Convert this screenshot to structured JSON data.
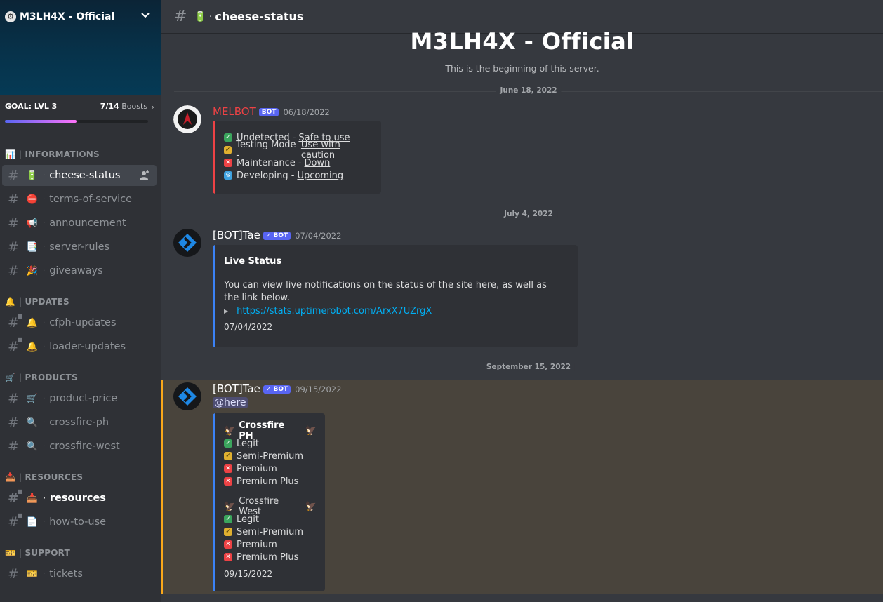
{
  "server": {
    "name": "M3LH4X - Official",
    "goal_label": "GOAL: LVL 3",
    "boost_count": "7/14",
    "boost_label": "Boosts",
    "boost_progress": 0.5
  },
  "sidebar": {
    "categories": [
      {
        "emoji": "📊",
        "label": "| INFORMATIONS"
      },
      {
        "emoji": "🔔",
        "label": "| UPDATES"
      },
      {
        "emoji": "🛒",
        "label": "| PRODUCTS"
      },
      {
        "emoji": "📥",
        "label": "| RESOURCES"
      },
      {
        "emoji": "🎫",
        "label": "| SUPPORT"
      }
    ],
    "channels": [
      {
        "emoji": "🔋",
        "label": "cheese-status"
      },
      {
        "emoji": "⛔",
        "label": "terms-of-service"
      },
      {
        "emoji": "📢",
        "label": "announcement"
      },
      {
        "emoji": "📑",
        "label": "server-rules"
      },
      {
        "emoji": "🎉",
        "label": "giveaways"
      },
      {
        "emoji": "🔔",
        "label": "cfph-updates"
      },
      {
        "emoji": "🔔",
        "label": "loader-updates"
      },
      {
        "emoji": "🛒",
        "label": "product-price"
      },
      {
        "emoji": "🔍",
        "label": "crossfire-ph"
      },
      {
        "emoji": "🔍",
        "label": "crossfire-west"
      },
      {
        "emoji": "📥",
        "label": "resources"
      },
      {
        "emoji": "📄",
        "label": "how-to-use"
      },
      {
        "emoji": "🎫",
        "label": "tickets"
      }
    ],
    "dot": "·"
  },
  "topbar": {
    "hash": "#",
    "emoji": "🔋",
    "dot": "·",
    "channel": "cheese-status"
  },
  "welcome": {
    "title": "M3LH4X - Official",
    "subtitle": "This is the beginning of this server."
  },
  "dividers": [
    "June 18, 2022",
    "July 4, 2022",
    "September 15, 2022"
  ],
  "messages": [
    {
      "author": "MELBOT",
      "author_color": "#ed4245",
      "badge": "BOT",
      "timestamp": "06/18/2022",
      "lines": [
        {
          "icon": "ok",
          "text": "Undetected -",
          "link": "Safe to use"
        },
        {
          "icon": "warn",
          "text": "Testing Mode -",
          "link": "Use with caution"
        },
        {
          "icon": "down",
          "text": "Maintenance -",
          "link": "Down"
        },
        {
          "icon": "dev",
          "text": "Developing -",
          "link": "Upcoming"
        }
      ]
    },
    {
      "author": "[BOT]Tae",
      "author_color": "#ffffff",
      "badge": "✓ BOT",
      "timestamp": "07/04/2022",
      "embed_title": "Live Status",
      "embed_text": "You can view live notifications on the status of the site here, as well as the link below.",
      "embed_link": "https://stats.uptimerobot.com/ArxX7UZrgX",
      "embed_footer": "07/04/2022"
    },
    {
      "author": "[BOT]Tae",
      "author_color": "#ffffff",
      "badge": "✓ BOT",
      "timestamp": "09/15/2022",
      "mention": "@here",
      "sections": [
        {
          "title": "Crossfire PH",
          "items": [
            "Legit",
            "Semi-Premium",
            "Premium",
            "Premium Plus"
          ]
        },
        {
          "title": "Crossfire West",
          "items": [
            "Legit",
            "Semi-Premium",
            "Premium",
            "Premium Plus"
          ]
        }
      ],
      "embed_footer": "09/15/2022"
    }
  ]
}
